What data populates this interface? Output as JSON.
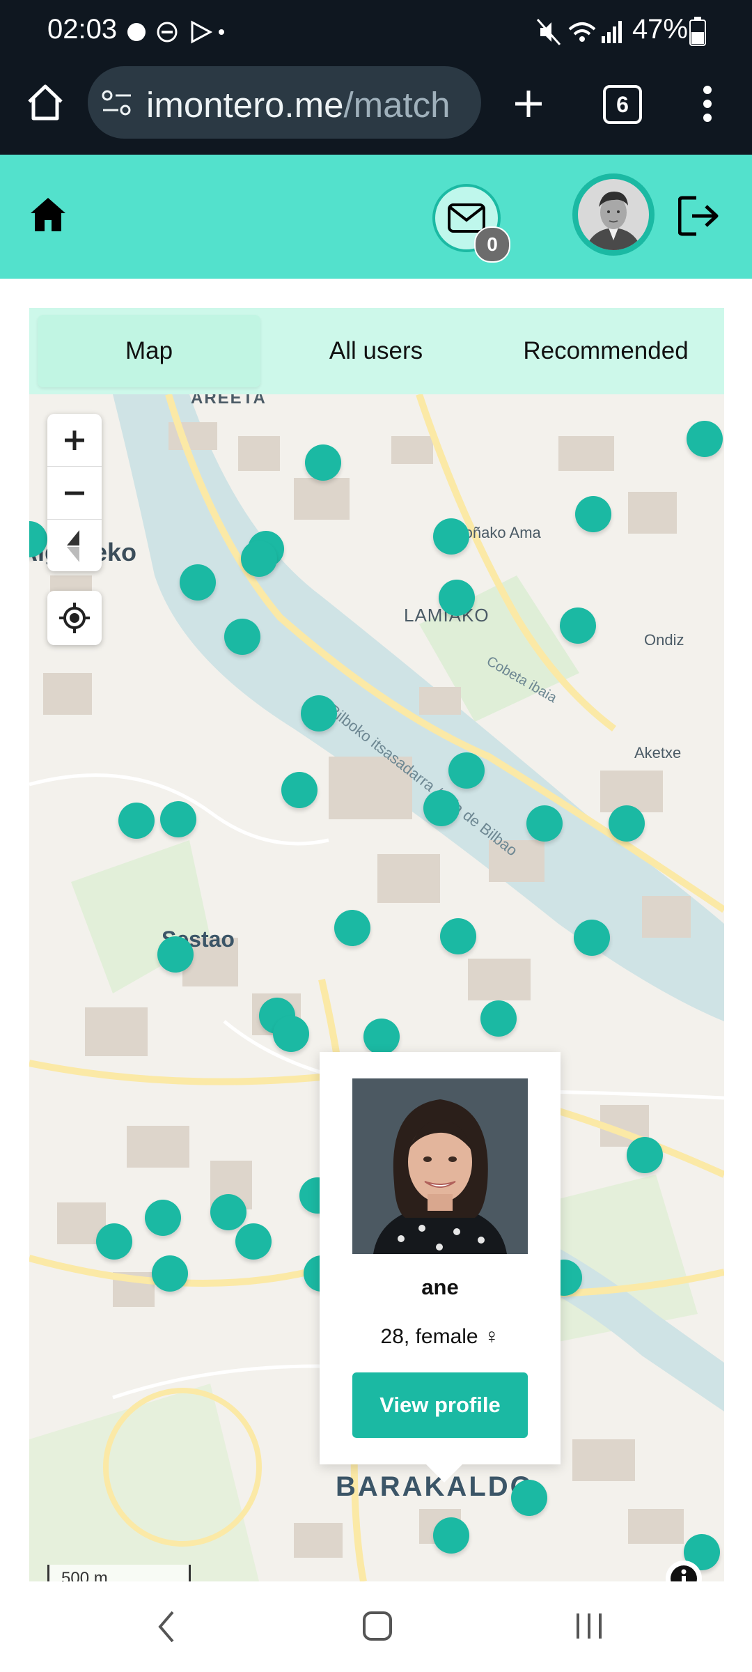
{
  "status_bar": {
    "time": "02:03",
    "battery": "47%"
  },
  "browser": {
    "url_host": "imontero.me",
    "url_path": "/match",
    "tab_count": "6"
  },
  "nav": {
    "messages_count": "0"
  },
  "tabs": [
    {
      "label": "Map",
      "active": true
    },
    {
      "label": "All users",
      "active": false
    },
    {
      "label": "Recommended",
      "active": false
    }
  ],
  "map": {
    "labels": {
      "areeta": "AREETA",
      "lamiako": "LAMIAKO",
      "ondiz": "Ondiz",
      "aketxe": "Aketxe",
      "sestao": "Sestao",
      "barakaldo": "BARAKALDO",
      "bonako_ama": "Boñako Ama",
      "river": "Bilboko itsasadarra / Ría de Bilbao",
      "cobeta": "Cobeta ibaia",
      "getxo_partial": "Algorteko"
    },
    "scale": "500 m"
  },
  "popup": {
    "name": "ane",
    "info": "28, female ♀",
    "button": "View profile"
  },
  "colors": {
    "accent": "#53e1cc",
    "marker": "#1bb9a3",
    "tab_bg": "#cdf8ea",
    "status_bar": "#0f1720"
  }
}
